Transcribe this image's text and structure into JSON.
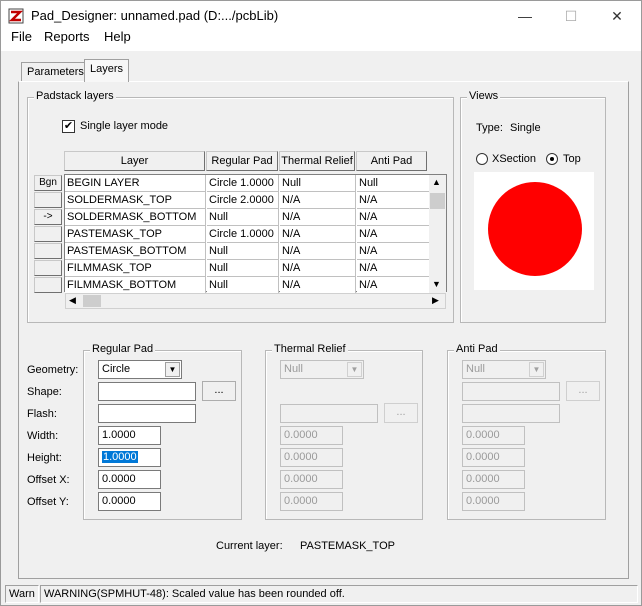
{
  "window": {
    "title": "Pad_Designer: unnamed.pad (D:.../pcbLib)",
    "icon": "pad-designer-app-icon"
  },
  "controls": {
    "minimize": "—",
    "maximize": "☐",
    "close": "✕"
  },
  "menu": [
    "File",
    "Reports",
    "Help"
  ],
  "tabs": {
    "parameters": "Parameters",
    "layers": "Layers"
  },
  "padstack_layers": {
    "group_label": "Padstack layers",
    "single_layer_mode_label": "Single layer mode",
    "single_layer_mode_checked": true,
    "columns": [
      "Layer",
      "Regular Pad",
      "Thermal Relief",
      "Anti Pad"
    ],
    "row_header_label": "Bgn",
    "row_buttons": [
      "",
      "->",
      "",
      "",
      "",
      "",
      ""
    ],
    "rows": [
      [
        "BEGIN LAYER",
        "Circle 1.0000",
        "Null",
        "Null"
      ],
      [
        "SOLDERMASK_TOP",
        "Circle 2.0000",
        "N/A",
        "N/A"
      ],
      [
        "SOLDERMASK_BOTTOM",
        "Null",
        "N/A",
        "N/A"
      ],
      [
        "PASTEMASK_TOP",
        "Circle 1.0000",
        "N/A",
        "N/A"
      ],
      [
        "PASTEMASK_BOTTOM",
        "Null",
        "N/A",
        "N/A"
      ],
      [
        "FILMMASK_TOP",
        "Null",
        "N/A",
        "N/A"
      ],
      [
        "FILMMASK_BOTTOM",
        "Null",
        "N/A",
        "N/A"
      ]
    ]
  },
  "views": {
    "group_label": "Views",
    "type_label": "Type:",
    "type_value": "Single",
    "xsection_label": "XSection",
    "top_label": "Top",
    "selected_view": "Top",
    "preview_color": "#ff0000"
  },
  "regular_pad": {
    "group_label": "Regular Pad",
    "geometry_label": "Geometry:",
    "geometry": "Circle",
    "shape_label": "Shape:",
    "shape": "",
    "flash_label": "Flash:",
    "flash": "",
    "width_label": "Width:",
    "width": "1.0000",
    "height_label": "Height:",
    "height": "1.0000",
    "offset_x_label": "Offset X:",
    "offset_x": "0.0000",
    "offset_y_label": "Offset Y:",
    "offset_y": "0.0000",
    "browse_label": "..."
  },
  "thermal_relief": {
    "group_label": "Thermal Relief",
    "geometry": "Null",
    "width": "0.0000",
    "height": "0.0000",
    "offset_x": "0.0000",
    "offset_y": "0.0000",
    "browse_label": "..."
  },
  "anti_pad": {
    "group_label": "Anti Pad",
    "geometry": "Null",
    "width": "0.0000",
    "height": "0.0000",
    "offset_x": "0.0000",
    "offset_y": "0.0000",
    "browse_label": "..."
  },
  "current_layer": {
    "label": "Current layer:",
    "value": "PASTEMASK_TOP"
  },
  "status": {
    "mode": "Warn",
    "message": "WARNING(SPMHUT-48): Scaled value has been rounded off."
  }
}
